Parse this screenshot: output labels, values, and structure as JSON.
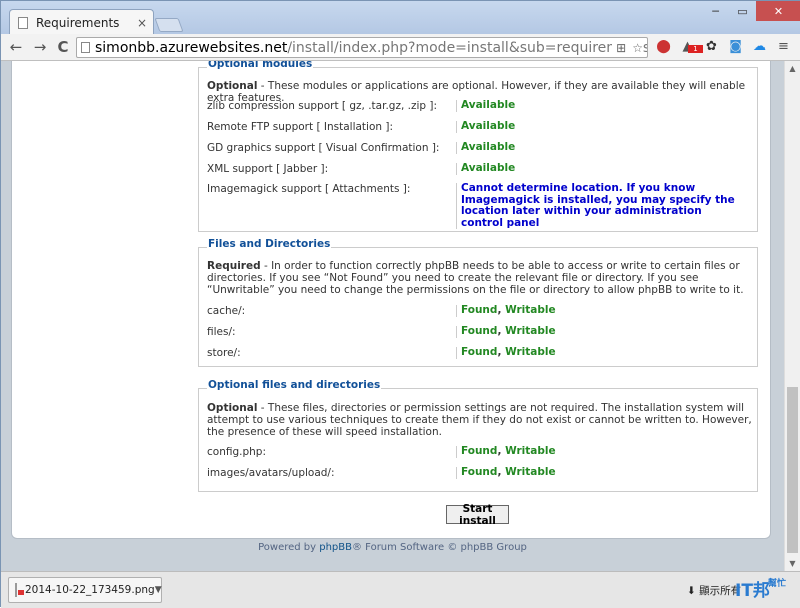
{
  "browser": {
    "tab_title": "Requirements",
    "tab_close": "×",
    "url_host": "simonbb.azurewebsites.net",
    "url_path": "/install/index.php?mode=install&sub=requirements&language=e",
    "back": "←",
    "forward": "→",
    "reload": "C",
    "window_controls": [
      "─",
      "▭",
      "✕"
    ],
    "notification_badge": "1"
  },
  "sections": {
    "optional_modules": {
      "legend": "Optional modules",
      "intro_bold": "Optional",
      "intro_text": " - These modules or applications are optional. However, if they are available they will enable extra features.",
      "rows": [
        {
          "label": "zlib compression support [ gz, .tar.gz, .zip ]:",
          "status": "Available"
        },
        {
          "label": "Remote FTP support [ Installation ]:",
          "status": "Available"
        },
        {
          "label": "GD graphics support [ Visual Confirmation ]:",
          "status": "Available"
        },
        {
          "label": "XML support [ Jabber ]:",
          "status": "Available"
        },
        {
          "label": "Imagemagick support [ Attachments ]:",
          "status": "Cannot determine location. If you know Imagemagick is installed, you may specify the location later within your administration control panel"
        }
      ]
    },
    "files_dirs": {
      "legend": "Files and Directories",
      "intro_bold": "Required",
      "intro_text": " - In order to function correctly phpBB needs to be able to access or write to certain files or directories. If you see “Not Found” you need to create the relevant file or directory. If you see “Unwritable” you need to change the permissions on the file or directory to allow phpBB to write to it.",
      "rows": [
        {
          "label": "cache/:",
          "found": "Found",
          "writable": "Writable"
        },
        {
          "label": "files/:",
          "found": "Found",
          "writable": "Writable"
        },
        {
          "label": "store/:",
          "found": "Found",
          "writable": "Writable"
        }
      ]
    },
    "optional_files": {
      "legend": "Optional files and directories",
      "intro_bold": "Optional",
      "intro_text": " - These files, directories or permission settings are not required. The installation system will attempt to use various techniques to create them if they do not exist or cannot be written to. However, the presence of these will speed installation.",
      "rows": [
        {
          "label": "config.php:",
          "found": "Found",
          "writable": "Writable"
        },
        {
          "label": "images/avatars/upload/:",
          "found": "Found",
          "writable": "Writable"
        }
      ]
    }
  },
  "start_button": "Start install",
  "footer": {
    "prefix": "Powered by ",
    "brand": "phpBB",
    "suffix": "® Forum Software © phpBB Group"
  },
  "download_bar": {
    "file_name": "2014-10-22_173459.png",
    "show_all": "顯示所有",
    "watermark": "IT邦",
    "watermark_sub": "幫忙"
  },
  "colors": {
    "ok": "#228822",
    "warn": "#0000cc",
    "legend": "#115098"
  }
}
